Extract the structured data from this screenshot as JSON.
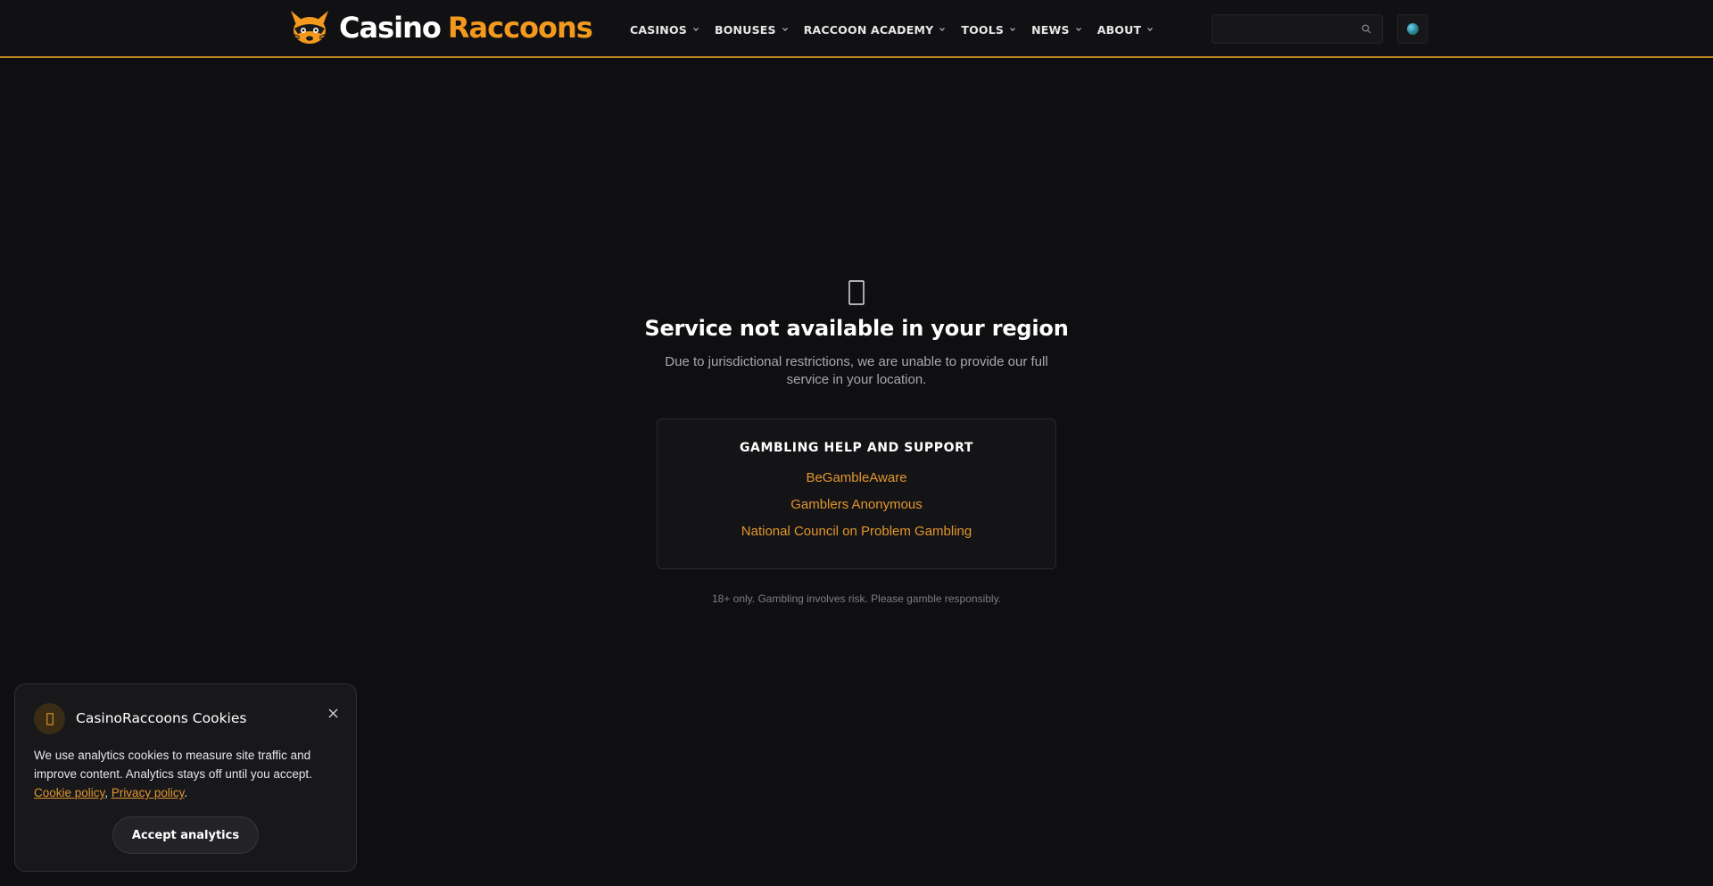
{
  "brand": {
    "name_part1": "Casino",
    "name_part2": "Raccoons",
    "accent_color": "#f2991e"
  },
  "nav": {
    "items": [
      {
        "label": "CASINOS",
        "icon": "chevron-down-icon"
      },
      {
        "label": "BONUSES",
        "icon": "chevron-down-icon"
      },
      {
        "label": "RACCOON ACADEMY",
        "icon": "chevron-down-icon"
      },
      {
        "label": "TOOLS",
        "icon": "chevron-down-icon"
      },
      {
        "label": "NEWS",
        "icon": "chevron-down-icon"
      },
      {
        "label": "ABOUT",
        "icon": "chevron-down-icon"
      }
    ]
  },
  "search": {
    "placeholder": "",
    "value": "",
    "icon": "search-icon"
  },
  "locale": {
    "icon": "globe-icon"
  },
  "blocked": {
    "icon": "lock-icon",
    "title": "Service not available in your region",
    "description": "Due to jurisdictional restrictions, we are unable to provide our full service in your location."
  },
  "help": {
    "title": "GAMBLING HELP AND SUPPORT",
    "links": [
      "BeGambleAware",
      "Gamblers Anonymous",
      "National Council on Problem Gambling"
    ]
  },
  "disclaimer": "18+ only. Gambling involves risk. Please gamble responsibly.",
  "cookie_banner": {
    "title": "CasinoRaccoons Cookies",
    "body": "We use analytics cookies to measure site traffic and improve content. Analytics stays off until you accept.",
    "cookie_policy_link": "Cookie policy",
    "separator": ", ",
    "privacy_policy_link": "Privacy policy",
    "trailing": ".",
    "accept_label": "Accept analytics",
    "close_icon": "close-icon"
  }
}
